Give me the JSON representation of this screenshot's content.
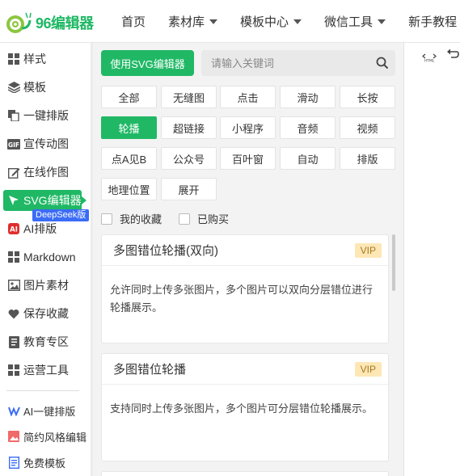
{
  "header": {
    "brand": "96编辑器",
    "nav": [
      {
        "label": "首页",
        "dropdown": false
      },
      {
        "label": "素材库",
        "dropdown": true
      },
      {
        "label": "模板中心",
        "dropdown": true
      },
      {
        "label": "微信工具",
        "dropdown": true
      },
      {
        "label": "新手教程",
        "dropdown": true
      }
    ]
  },
  "sidebar": {
    "items": [
      {
        "label": "样式",
        "icon": "grid-icon"
      },
      {
        "label": "模板",
        "icon": "layers-icon"
      },
      {
        "label": "一键排版",
        "icon": "copy-icon"
      },
      {
        "label": "宣传动图",
        "icon": "gif-icon"
      },
      {
        "label": "在线作图",
        "icon": "edit-icon"
      },
      {
        "label": "SVG编辑器",
        "icon": "cursor-icon",
        "active": true
      },
      {
        "label": "AI排版",
        "icon": "ai-icon"
      },
      {
        "label": "Markdown",
        "icon": "grid-icon"
      },
      {
        "label": "图片素材",
        "icon": "image-icon"
      },
      {
        "label": "保存收藏",
        "icon": "heart-icon"
      },
      {
        "label": "教育专区",
        "icon": "book-icon"
      },
      {
        "label": "运营工具",
        "icon": "grid-icon"
      },
      {
        "label": "AI一键排版",
        "icon": "ai-brain-icon"
      },
      {
        "label": "简约风格编辑",
        "icon": "picture-icon"
      },
      {
        "label": "免费模板",
        "icon": "document-icon"
      }
    ],
    "badge": "DeepSeek版"
  },
  "panel": {
    "svg_button": "使用SVG编辑器",
    "search_placeholder": "请输入关键词",
    "tags": [
      "全部",
      "无缝图",
      "点击",
      "滑动",
      "长按",
      "轮播",
      "超链接",
      "小程序",
      "音频",
      "视频",
      "点A见B",
      "公众号",
      "百叶窗",
      "自动",
      "排版",
      "地理位置",
      "展开"
    ],
    "active_tag": "轮播",
    "checkboxes": [
      "我的收藏",
      "已购买"
    ],
    "cards": [
      {
        "title": "多图错位轮播(双向)",
        "badge": "VIP",
        "desc": "允许同时上传多张图片，多个图片可以双向分层错位进行轮播展示。"
      },
      {
        "title": "多图错位轮播",
        "badge": "VIP",
        "desc": "支持同时上传多张图片，多个图片可分层错位轮播展示。"
      }
    ]
  },
  "toolbar": {
    "html_icon": "HTML",
    "undo_icon": "undo-icon"
  },
  "colors": {
    "accent": "#20b865",
    "badge_blue": "#3b6cf6",
    "vip_bg": "#fde7b5"
  }
}
